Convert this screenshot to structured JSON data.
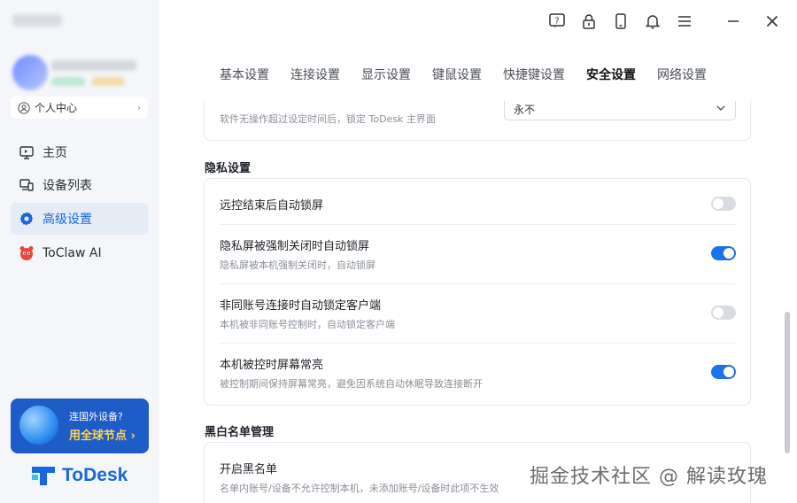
{
  "sidebar": {
    "personal_center_label": "个人中心",
    "nav": [
      {
        "label": "主页"
      },
      {
        "label": "设备列表"
      },
      {
        "label": "高级设置"
      },
      {
        "label": "ToClaw AI"
      }
    ],
    "promo": {
      "line1": "连国外设备?",
      "line2": "用全球节点 ›"
    },
    "logo_text": "ToDesk"
  },
  "tabs": [
    "基本设置",
    "连接设置",
    "显示设置",
    "键鼠设置",
    "快捷键设置",
    "安全设置",
    "网络设置"
  ],
  "active_tab": "安全设置",
  "lock_card": {
    "description": "软件无操作超过设定时间后，锁定 ToDesk 主界面",
    "select_value": "永不"
  },
  "privacy": {
    "title": "隐私设置",
    "rows": [
      {
        "title": "远控结束后自动锁屏",
        "sub": "",
        "on": false
      },
      {
        "title": "隐私屏被强制关闭时自动锁屏",
        "sub": "隐私屏被本机强制关闭时，自动锁屏",
        "on": true
      },
      {
        "title": "非同账号连接时自动锁定客户端",
        "sub": "本机被非同账号控制时，自动锁定客户端",
        "on": false
      },
      {
        "title": "本机被控时屏幕常亮",
        "sub": "被控制期间保持屏幕常亮，避免因系统自动休眠导致连接断开",
        "on": true
      }
    ]
  },
  "blacklist": {
    "title": "黑白名单管理",
    "row_title": "开启黑名单",
    "row_sub": "名单内账号/设备不允许控制本机，未添加账号/设备时此项不生效"
  },
  "watermark": "掘金技术社区 @ 解读玫瑰",
  "colors": {
    "accent": "#1a73e8",
    "sidebar_bg": "#f4f6f9"
  }
}
